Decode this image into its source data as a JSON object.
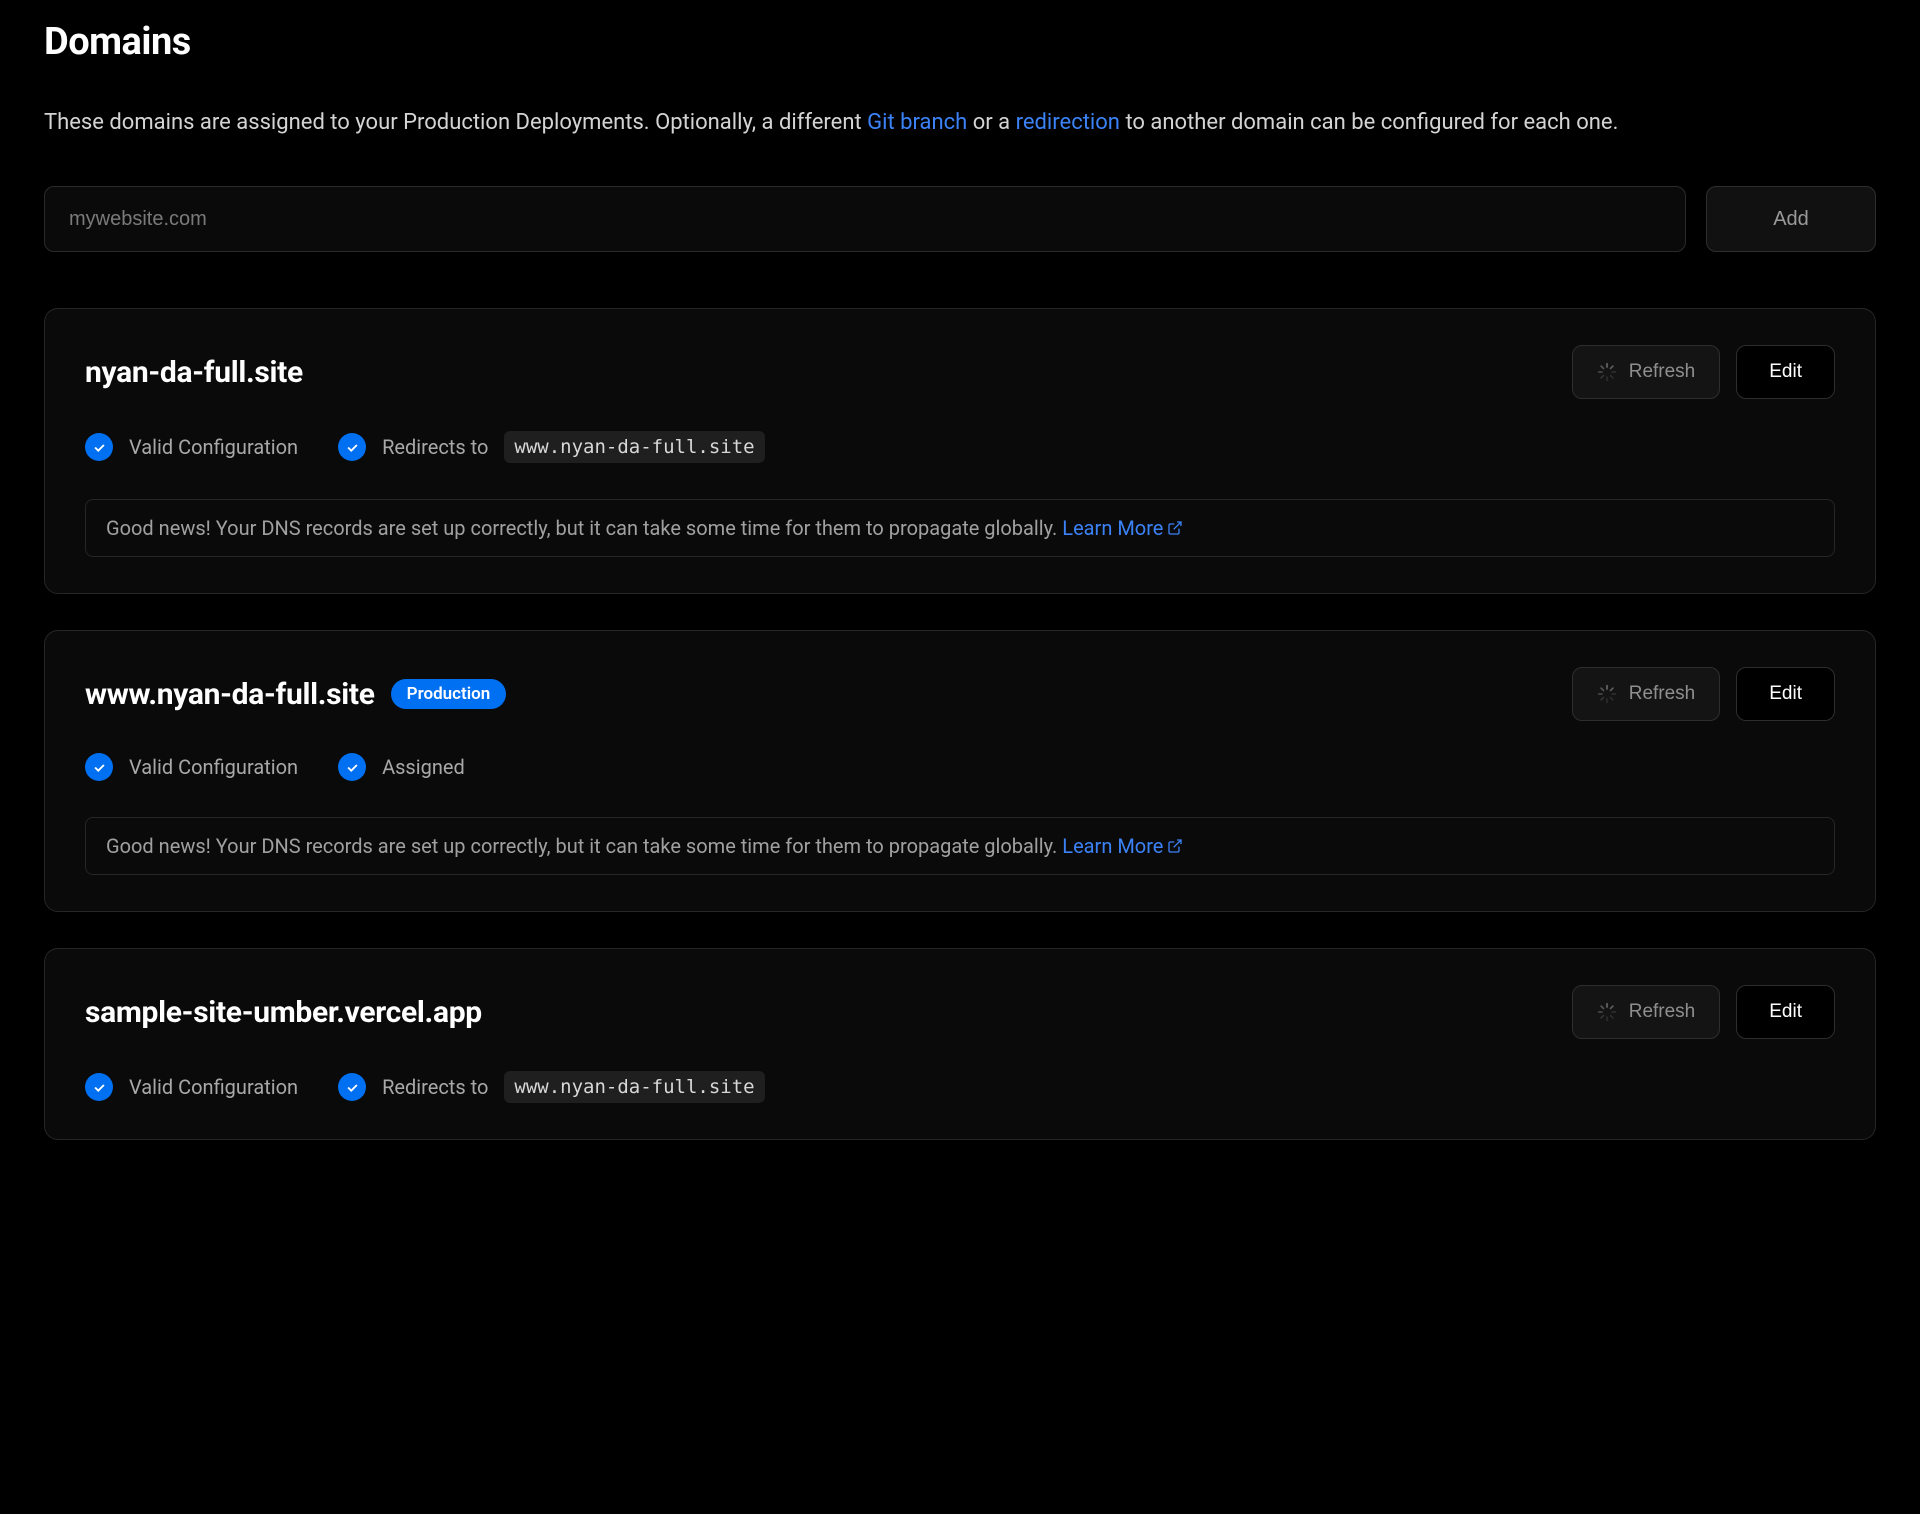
{
  "header": {
    "title": "Domains",
    "description_prefix": "These domains are assigned to your Production Deployments. Optionally, a different ",
    "git_branch_link": "Git branch",
    "description_mid": " or a ",
    "redirection_link": "redirection",
    "description_suffix": " to another domain can be configured for each one."
  },
  "add": {
    "placeholder": "mywebsite.com",
    "button_label": "Add"
  },
  "buttons": {
    "refresh": "Refresh",
    "edit": "Edit"
  },
  "status_labels": {
    "valid_configuration": "Valid Configuration",
    "redirects_to": "Redirects to",
    "assigned": "Assigned"
  },
  "notice": {
    "text": "Good news! Your DNS records are set up correctly, but it can take some time for them to propagate globally. ",
    "learn_more": "Learn More"
  },
  "domains": [
    {
      "name": "nyan-da-full.site",
      "badge": null,
      "statuses": [
        {
          "type": "valid"
        },
        {
          "type": "redirects",
          "target": "www.nyan-da-full.site"
        }
      ],
      "has_notice": true
    },
    {
      "name": "www.nyan-da-full.site",
      "badge": "Production",
      "statuses": [
        {
          "type": "valid"
        },
        {
          "type": "assigned"
        }
      ],
      "has_notice": true
    },
    {
      "name": "sample-site-umber.vercel.app",
      "badge": null,
      "statuses": [
        {
          "type": "valid"
        },
        {
          "type": "redirects",
          "target": "www.nyan-da-full.site"
        }
      ],
      "has_notice": false
    }
  ]
}
